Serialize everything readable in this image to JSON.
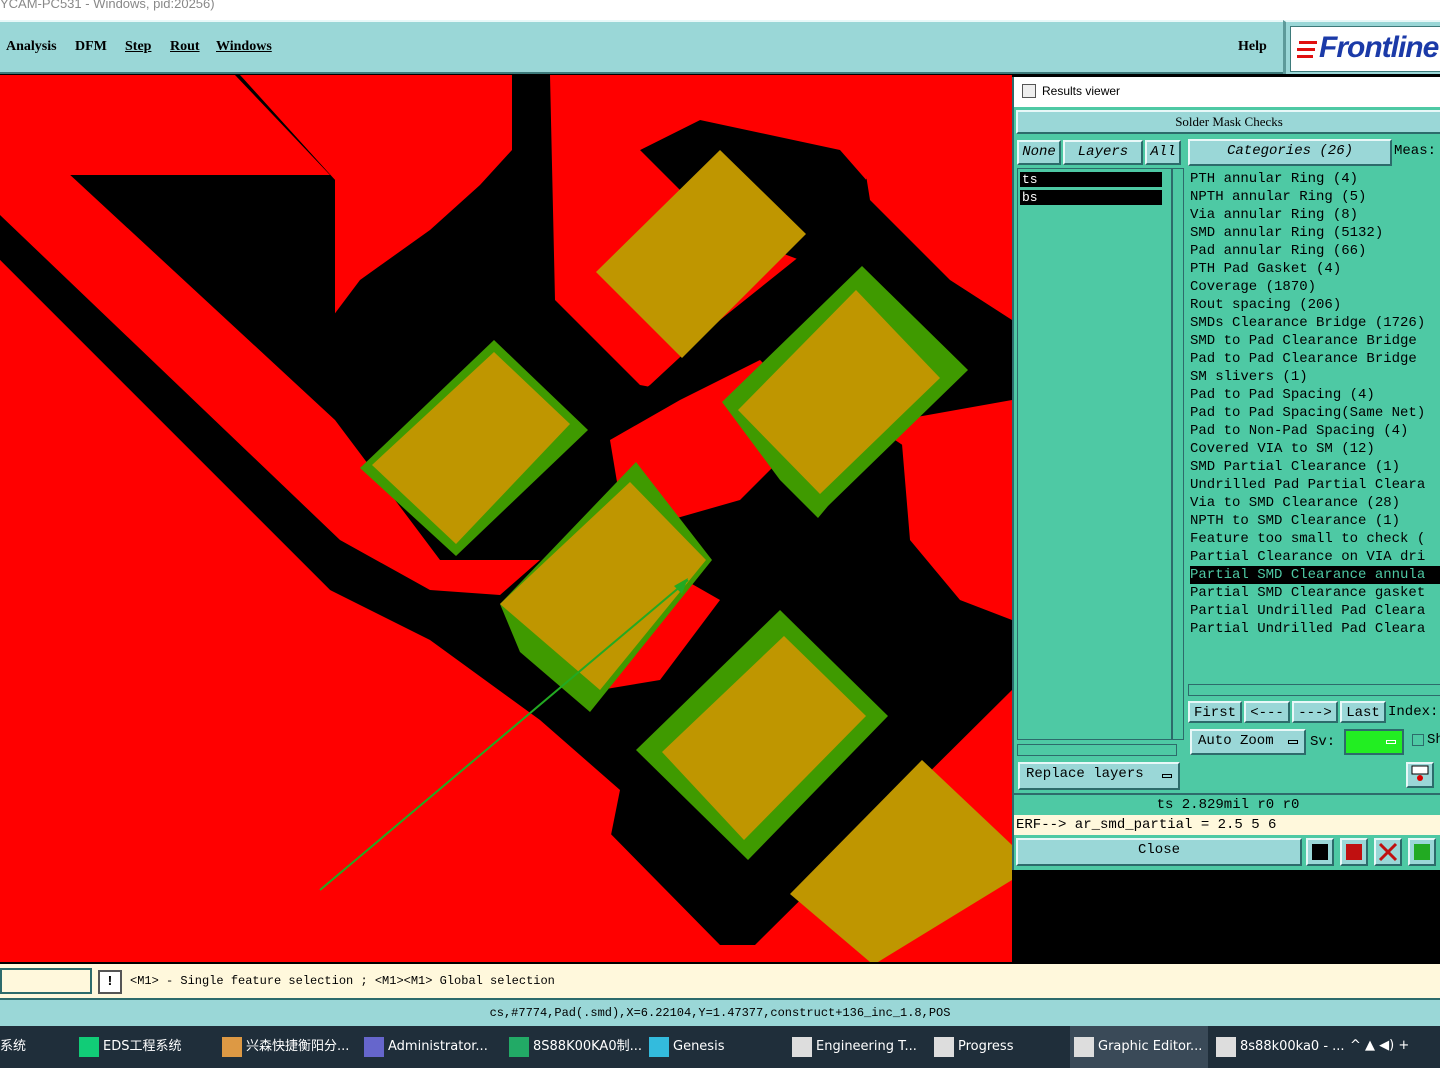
{
  "window": {
    "title": "YCAM-PC531 - Windows, pid:20256)"
  },
  "menubar": {
    "items": [
      "Analysis",
      "DFM",
      "Step",
      "Rout",
      "Windows"
    ],
    "help": "Help",
    "logo": "Frontline"
  },
  "results_viewer": {
    "title": "Results viewer",
    "header": "Solder Mask Checks",
    "btn_none": "None",
    "btn_layers": "Layers",
    "btn_all": "All",
    "btn_categories": "Categories (26)",
    "meas_label": "Meas:",
    "layers": [
      "ts",
      "bs"
    ],
    "categories": [
      "PTH annular Ring (4)",
      "NPTH annular Ring (5)",
      "Via annular Ring (8)",
      "SMD annular Ring (5132)",
      "Pad annular Ring (66)",
      "PTH Pad Gasket (4)",
      "Coverage (1870)",
      "Rout spacing (206)",
      "SMDs Clearance Bridge (1726)",
      "SMD to Pad Clearance Bridge",
      "Pad to Pad Clearance Bridge",
      "SM slivers (1)",
      "Pad to Pad Spacing (4)",
      "Pad to Pad Spacing(Same Net)",
      "Pad to Non-Pad Spacing (4)",
      "Covered VIA to SM (12)",
      "SMD Partial Clearance (1)",
      "Undrilled Pad Partial Cleara",
      "Via to SMD Clearance (28)",
      "NPTH to SMD Clearance (1)",
      "Feature too small to check (",
      "Partial Clearance on VIA dri",
      "Partial SMD Clearance annula",
      "Partial SMD Clearance gasket",
      "Partial Undrilled Pad Cleara",
      "Partial Undrilled Pad Cleara"
    ],
    "selected_category_index": 22,
    "nav": {
      "first": "First",
      "prev": "<---",
      "next": "--->",
      "last": "Last",
      "index": "Index:"
    },
    "auto_zoom": "Auto Zoom",
    "sv_label": "Sv:",
    "sh_label": "Sh",
    "replace_layers": "Replace layers",
    "status": "ts 2.829mil  r0  r0",
    "erf": "ERF--> ar_smd_partial = 2.5 5 6",
    "close": "Close",
    "colors": {
      "panel": "#4ec9a4",
      "button": "#9ad7d7",
      "sv_swatch": "#22ee22"
    }
  },
  "canvas": {
    "colors": {
      "copper": "#ff0000",
      "gap": "#000000",
      "pad": "#bf9600",
      "mask": "#3f9a00",
      "arrow": "#22aa22"
    }
  },
  "messagebar": {
    "btn": "!",
    "text": "<M1> - Single feature selection ; <M1><M1> Global selection"
  },
  "coordbar": {
    "text": "cs,#7774,Pad(.smd),X=6.22104,Y=1.47377,construct+136_inc_1.8,POS"
  },
  "taskbar": {
    "items": [
      {
        "label": "系统",
        "icon": "app-icon"
      },
      {
        "label": "EDS工程系统",
        "icon": "f-logo-icon"
      },
      {
        "label": "兴森快捷衡阳分...",
        "icon": "shell-icon"
      },
      {
        "label": "Administrator...",
        "icon": "floppy-icon"
      },
      {
        "label": "8S88K00KA0制...",
        "icon": "spreadsheet-icon"
      },
      {
        "label": "Genesis",
        "icon": "genesis-icon"
      },
      {
        "label": "Engineering T...",
        "icon": "x-window-icon"
      },
      {
        "label": "Progress",
        "icon": "x-window-icon"
      },
      {
        "label": "Graphic Editor...",
        "icon": "x-window-icon"
      },
      {
        "label": "8s88k00ka0 - ...",
        "icon": "x-window-icon"
      }
    ]
  }
}
